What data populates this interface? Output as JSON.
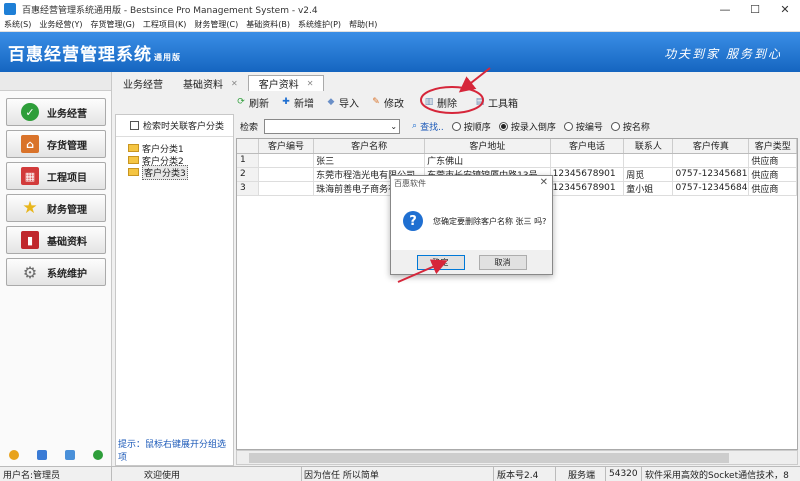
{
  "window": {
    "title": "百惠经营管理系统通用版 - Bestsince Pro Management System - v2.4",
    "controls": [
      "—",
      "☐",
      "✕"
    ]
  },
  "menu": [
    "系统(S)",
    "业务经营(Y)",
    "存货管理(G)",
    "工程项目(K)",
    "财务管理(C)",
    "基础资料(B)",
    "系统维护(P)",
    "帮助(H)"
  ],
  "banner": {
    "brand": "百惠经营管理系统",
    "edition": "通用版",
    "slogan": "功夫到家 服务到心"
  },
  "nav": [
    {
      "label": "业务经营",
      "icon": "check-icon",
      "color": "#2e9e3a"
    },
    {
      "label": "存货管理",
      "icon": "house-icon",
      "color": "#d9732a"
    },
    {
      "label": "工程项目",
      "icon": "grid-icon",
      "color": "#d23b3b"
    },
    {
      "label": "财务管理",
      "icon": "star-icon",
      "color": "#e8b61c"
    },
    {
      "label": "基础资料",
      "icon": "book-icon",
      "color": "#c0282d"
    },
    {
      "label": "系统维护",
      "icon": "gear-icon",
      "color": "#6b6b6b"
    }
  ],
  "tabs": [
    {
      "label": "业务经营",
      "active": false
    },
    {
      "label": "基础资料",
      "active": false
    },
    {
      "label": "客户资料",
      "active": true
    }
  ],
  "toolbar": {
    "refresh": "刷新",
    "add": "新增",
    "import": "导入",
    "edit": "修改",
    "delete": "删除",
    "toolbox": "工具箱"
  },
  "tree": {
    "checkbox_label": "检索时关联客户分类",
    "nodes": [
      "客户分类1",
      "客户分类2",
      "客户分类3"
    ],
    "hint": "提示：鼠标右键展开分组选项"
  },
  "search": {
    "label": "检索",
    "value": "",
    "find": "查找..",
    "options": [
      {
        "label": "按顺序",
        "checked": false
      },
      {
        "label": "按录入倒序",
        "checked": true
      },
      {
        "label": "按编号",
        "checked": false
      },
      {
        "label": "按名称",
        "checked": false
      }
    ]
  },
  "grid": {
    "columns": [
      "",
      "客户编号",
      "客户名称",
      "客户地址",
      "客户电话",
      "联系人",
      "客户传真",
      "客户类型"
    ],
    "rows": [
      [
        "1",
        "",
        "张三",
        "广东佛山",
        "",
        "",
        "",
        "供应商"
      ],
      [
        "2",
        "",
        "东莞市程浩光电有限公司",
        "东莞市长安镇锦厦中路13号",
        "12345678901",
        "周觅",
        "0757-12345681",
        "供应商"
      ],
      [
        "3",
        "",
        "珠海前善电子商务有限公司",
        "",
        "12345678901",
        "童小姐",
        "0757-12345684",
        "供应商"
      ]
    ]
  },
  "dialog": {
    "title": "百惠软件",
    "message": "您确定要删除客户名称 张三 吗?",
    "ok": "确定",
    "cancel": "取消"
  },
  "status": [
    "用户名:管理员",
    "欢迎使用",
    "因为信任 所以简单",
    "版本号2.4",
    "服务端",
    "54320",
    "软件采用高效的Socket通信技术，8"
  ],
  "colors": {
    "banner": "#1e7fd6",
    "annotation": "#d6263a",
    "link": "#1b59b8"
  }
}
